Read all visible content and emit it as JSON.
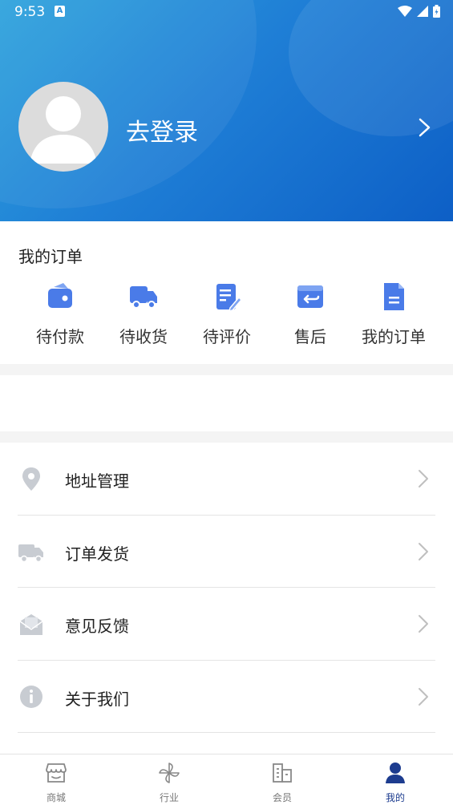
{
  "status_bar": {
    "time": "9:53",
    "notification_badge": "A"
  },
  "profile": {
    "login_label": "去登录"
  },
  "orders": {
    "title": "我的订单",
    "items": [
      {
        "label": "待付款",
        "icon": "wallet-icon"
      },
      {
        "label": "待收货",
        "icon": "truck-icon"
      },
      {
        "label": "待评价",
        "icon": "edit-review-icon"
      },
      {
        "label": "售后",
        "icon": "return-icon"
      },
      {
        "label": "我的订单",
        "icon": "document-icon"
      }
    ]
  },
  "menu": {
    "items": [
      {
        "label": "地址管理",
        "icon": "location-pin-icon"
      },
      {
        "label": "订单发货",
        "icon": "delivery-truck-icon"
      },
      {
        "label": "意见反馈",
        "icon": "mail-feedback-icon"
      },
      {
        "label": "关于我们",
        "icon": "info-icon"
      }
    ]
  },
  "tabbar": {
    "tabs": [
      {
        "label": "商城",
        "icon": "store-icon"
      },
      {
        "label": "行业",
        "icon": "pinwheel-icon"
      },
      {
        "label": "会员",
        "icon": "buildings-icon"
      },
      {
        "label": "我的",
        "icon": "person-icon"
      }
    ],
    "active": "我的"
  },
  "colors": {
    "header_gradient_start": "#2ea3dc",
    "header_gradient_end": "#0d5fc6",
    "order_icon_blue": "#4a7be8",
    "tab_active": "#1d3c8f",
    "menu_icon_gray": "#c8ccd2"
  }
}
